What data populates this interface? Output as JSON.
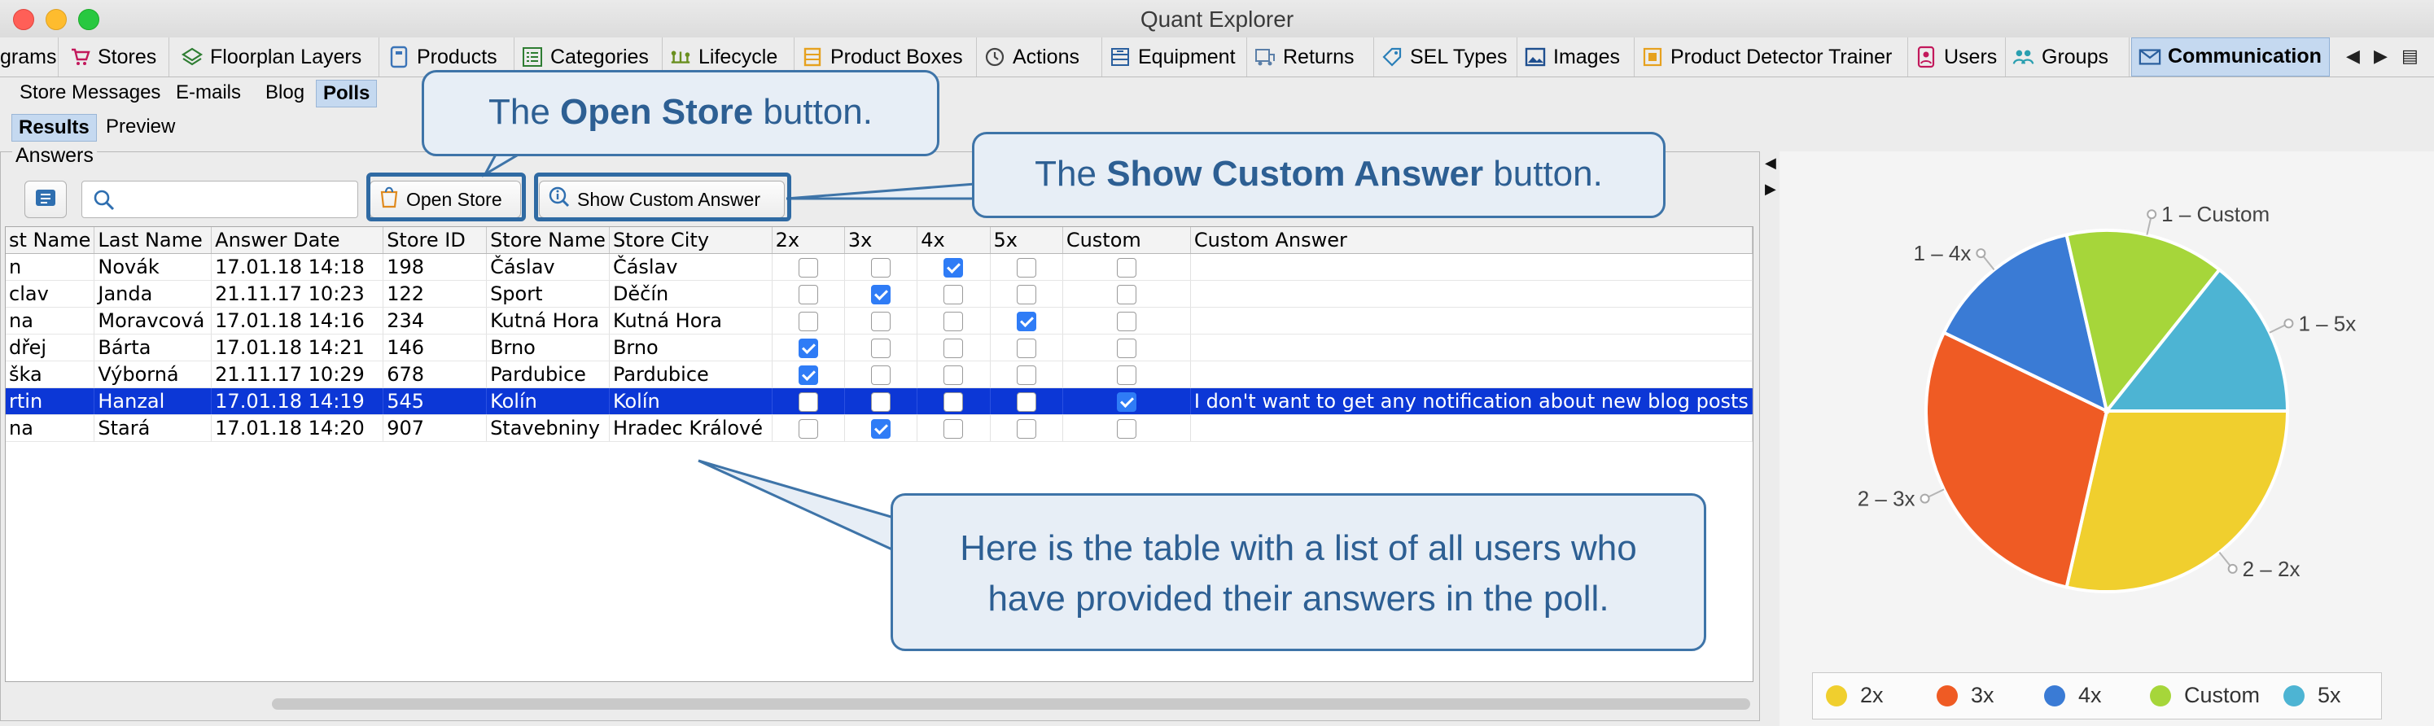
{
  "window": {
    "title": "Quant Explorer"
  },
  "tabs": [
    {
      "label": "grams",
      "icon": "none"
    },
    {
      "label": "Stores",
      "icon": "cart-icon"
    },
    {
      "label": "Floorplan Layers",
      "icon": "layers-icon"
    },
    {
      "label": "Products",
      "icon": "product-icon"
    },
    {
      "label": "Categories",
      "icon": "list-icon"
    },
    {
      "label": "Lifecycle",
      "icon": "lifecycle-icon"
    },
    {
      "label": "Product Boxes",
      "icon": "box-icon"
    },
    {
      "label": "Actions",
      "icon": "clock-icon"
    },
    {
      "label": "Equipment",
      "icon": "equipment-icon"
    },
    {
      "label": "Returns",
      "icon": "returns-icon"
    },
    {
      "label": "SEL Types",
      "icon": "tag-icon"
    },
    {
      "label": "Images",
      "icon": "image-icon"
    },
    {
      "label": "Product Detector Trainer",
      "icon": "detector-icon"
    },
    {
      "label": "Users",
      "icon": "user-icon"
    },
    {
      "label": "Groups",
      "icon": "groups-icon"
    },
    {
      "label": "Communication",
      "icon": "mail-icon"
    }
  ],
  "subtabs": [
    "Store Messages",
    "E-mails",
    "Blog",
    "Polls"
  ],
  "view_tabs": [
    "Results",
    "Preview"
  ],
  "answers": {
    "title": "Answers",
    "search_placeholder": "",
    "open_store_label": "Open Store",
    "show_custom_answer_label": "Show Custom Answer"
  },
  "table": {
    "columns": [
      "st Name",
      "Last Name",
      "Answer Date",
      "Store ID",
      "Store Name",
      "Store City",
      "2x",
      "3x",
      "4x",
      "5x",
      "Custom",
      "Custom Answer"
    ],
    "rows": [
      {
        "first": "n",
        "last": "Novák",
        "date": "17.01.18 14:18",
        "store_id": "198",
        "store_name": "Čáslav",
        "city": "Čáslav",
        "checks": [
          false,
          false,
          true,
          false,
          false
        ],
        "custom_answer": ""
      },
      {
        "first": "clav",
        "last": "Janda",
        "date": "21.11.17 10:23",
        "store_id": "122",
        "store_name": "Sport",
        "city": "Děčín",
        "checks": [
          false,
          true,
          false,
          false,
          false
        ],
        "custom_answer": ""
      },
      {
        "first": "na",
        "last": "Moravcová",
        "date": "17.01.18 14:16",
        "store_id": "234",
        "store_name": "Kutná Hora",
        "city": "Kutná Hora",
        "checks": [
          false,
          false,
          false,
          true,
          false
        ],
        "custom_answer": ""
      },
      {
        "first": "dřej",
        "last": "Bárta",
        "date": "17.01.18 14:21",
        "store_id": "146",
        "store_name": "Brno",
        "city": "Brno",
        "checks": [
          true,
          false,
          false,
          false,
          false
        ],
        "custom_answer": ""
      },
      {
        "first": "ška",
        "last": "Výborná",
        "date": "21.11.17 10:29",
        "store_id": "678",
        "store_name": "Pardubice",
        "city": "Pardubice",
        "checks": [
          true,
          false,
          false,
          false,
          false
        ],
        "custom_answer": ""
      },
      {
        "first": "rtin",
        "last": "Hanzal",
        "date": "17.01.18 14:19",
        "store_id": "545",
        "store_name": "Kolín",
        "city": "Kolín",
        "checks": [
          false,
          false,
          false,
          false,
          true
        ],
        "custom_answer": "I don't want to get any notification about new blog posts"
      },
      {
        "first": "na",
        "last": "Stará",
        "date": "17.01.18 14:20",
        "store_id": "907",
        "store_name": "Stavebniny",
        "city": "Hradec Králové",
        "checks": [
          false,
          true,
          false,
          false,
          false
        ],
        "custom_answer": ""
      }
    ]
  },
  "callouts": {
    "open_store": {
      "pre": "The ",
      "bold": "Open Store",
      "post": " button."
    },
    "show_custom": {
      "pre": "The ",
      "bold": "Show Custom Answer",
      "post": " button."
    },
    "table_note": {
      "line1": "Here is the table with a list of all users who",
      "line2": "have provided their answers in the poll."
    }
  },
  "chart_data": {
    "type": "pie",
    "slices": [
      {
        "name": "2x",
        "label": "2 – 2x",
        "value": 2,
        "color": "#f0cf2e"
      },
      {
        "name": "3x",
        "label": "2 – 3x",
        "value": 2,
        "color": "#ef5b24"
      },
      {
        "name": "4x",
        "label": "1 – 4x",
        "value": 1,
        "color": "#3a7bd5"
      },
      {
        "name": "Custom",
        "label": "1 – Custom",
        "value": 1,
        "color": "#a6d63a"
      },
      {
        "name": "5x",
        "label": "1 – 5x",
        "value": 1,
        "color": "#4db4d3"
      }
    ],
    "legend": [
      "2x",
      "3x",
      "4x",
      "Custom",
      "5x"
    ],
    "legend_position": "bottom"
  }
}
